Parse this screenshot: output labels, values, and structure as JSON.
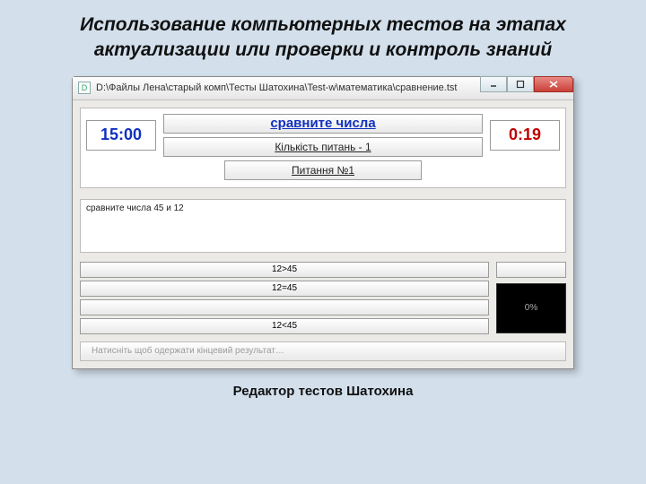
{
  "slide": {
    "title": "Использование компьютерных тестов на этапах актуализации или проверки и контроль знаний",
    "caption": "Редактор тестов Шатохина"
  },
  "window": {
    "app_icon_letter": "D",
    "title_path": "D:\\Файлы Лена\\старый комп\\Тесты Шатохина\\Test-w\\математика\\сравнение.tst"
  },
  "top": {
    "time_limit": "15:00",
    "elapsed": "0:19",
    "test_title": "сравните числа",
    "count_label": "Кількість питань - 1",
    "question_label": "Питання №1"
  },
  "question": {
    "text": "сравните числа 45 и 12"
  },
  "answers": [
    "12>45",
    "12=45",
    "",
    "12<45"
  ],
  "progress": {
    "percent_label": "0%"
  },
  "footer": {
    "hint": "Натисніть щоб одержати кінцевий результат…"
  }
}
